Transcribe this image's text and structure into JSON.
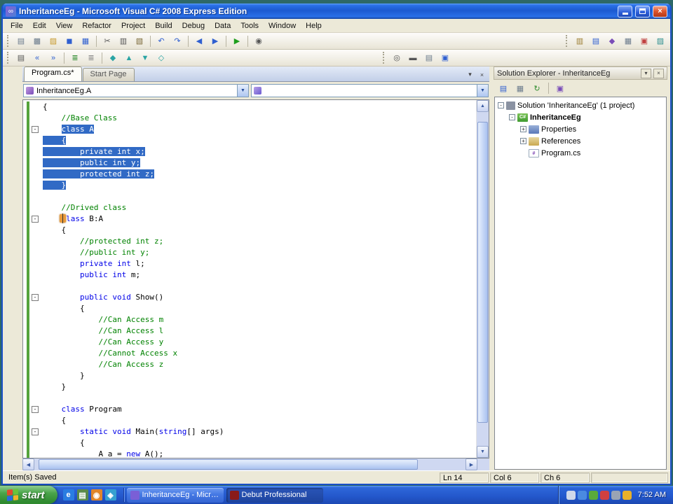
{
  "window": {
    "title": "InheritanceEg - Microsoft Visual C# 2008 Express Edition"
  },
  "colors": {
    "selection": "#316AC5",
    "keyword": "#0000E8",
    "comment": "#008200",
    "titlebar_blue": "#2a70e8",
    "taskbar_blue": "#2458cc",
    "start_green": "#3f9c3f",
    "change_bar_green": "#55a33c",
    "desktop_teal": "#2e6868"
  },
  "menu": {
    "items": [
      "File",
      "Edit",
      "View",
      "Refactor",
      "Project",
      "Build",
      "Debug",
      "Data",
      "Tools",
      "Window",
      "Help"
    ]
  },
  "toolbars": {
    "row1": [
      {
        "name": "new-project-button",
        "glyph": "▤",
        "color": "#6b7b8c"
      },
      {
        "name": "add-new-item-button",
        "glyph": "▩",
        "color": "#6b7b8c"
      },
      {
        "name": "open-file-button",
        "glyph": "▨",
        "color": "#c79a2e"
      },
      {
        "name": "save-button",
        "glyph": "◼",
        "color": "#2f5fd0"
      },
      {
        "name": "save-all-button",
        "glyph": "▦",
        "color": "#2f5fd0"
      },
      {
        "sep": true
      },
      {
        "name": "cut-button",
        "glyph": "✂",
        "color": "#555555"
      },
      {
        "name": "copy-button",
        "glyph": "▥",
        "color": "#555555"
      },
      {
        "name": "paste-button",
        "glyph": "▧",
        "color": "#7c6a3a"
      },
      {
        "sep": true
      },
      {
        "name": "undo-button",
        "glyph": "↶",
        "color": "#2f5fd0"
      },
      {
        "name": "redo-button",
        "glyph": "↷",
        "color": "#2f5fd0"
      },
      {
        "sep": true
      },
      {
        "name": "navigate-backward-button",
        "glyph": "◀",
        "color": "#2f5fd0"
      },
      {
        "name": "navigate-forward-button",
        "glyph": "▶",
        "color": "#2f5fd0"
      },
      {
        "sep": true
      },
      {
        "name": "start-debugging-button",
        "glyph": "▶",
        "color": "#1d9e1d"
      },
      {
        "sep": true
      },
      {
        "name": "find-button",
        "glyph": "◉",
        "color": "#555555"
      }
    ],
    "row1_right": [
      {
        "name": "solution-explorer-button",
        "glyph": "▥",
        "color": "#9a7b2e"
      },
      {
        "name": "properties-window-button",
        "glyph": "▤",
        "color": "#2f5fd0"
      },
      {
        "name": "object-browser-button",
        "glyph": "◆",
        "color": "#7a4db8"
      },
      {
        "name": "toolbox-button",
        "glyph": "▦",
        "color": "#6b7b8c"
      },
      {
        "name": "error-list-button",
        "glyph": "▣",
        "color": "#c04040"
      },
      {
        "name": "start-page-button",
        "glyph": "▨",
        "color": "#2f8f8f"
      }
    ],
    "row2": [
      {
        "name": "display-member-list-button",
        "glyph": "▤",
        "color": "#555555"
      },
      {
        "name": "decrease-indent-button",
        "glyph": "«",
        "color": "#2f5fd0"
      },
      {
        "name": "increase-indent-button",
        "glyph": "»",
        "color": "#2f5fd0"
      },
      {
        "sep": true
      },
      {
        "name": "comment-selection-button",
        "glyph": "≣",
        "color": "#2e8b2e"
      },
      {
        "name": "uncomment-selection-button",
        "glyph": "≣",
        "color": "#888888"
      },
      {
        "sep": true
      },
      {
        "name": "toggle-bookmark-button",
        "glyph": "◆",
        "color": "#2aa4a4"
      },
      {
        "name": "previous-bookmark-button",
        "glyph": "▲",
        "color": "#2aa4a4"
      },
      {
        "name": "next-bookmark-button",
        "glyph": "▼",
        "color": "#2aa4a4"
      },
      {
        "name": "clear-bookmarks-button",
        "glyph": "◇",
        "color": "#2aa4a4"
      }
    ],
    "row2_right": [
      {
        "name": "find-symbol-button",
        "glyph": "◎",
        "color": "#555555"
      },
      {
        "name": "command-window-button",
        "glyph": "▬",
        "color": "#555555"
      },
      {
        "name": "output-window-button",
        "glyph": "▤",
        "color": "#6b7b8c"
      },
      {
        "name": "immediate-window-button",
        "glyph": "▣",
        "color": "#2f5fd0"
      }
    ]
  },
  "tabs": [
    {
      "label": "Program.cs*",
      "active": true
    },
    {
      "label": "Start Page",
      "active": false
    }
  ],
  "navbar": {
    "types_value": "InheritanceEg.A",
    "members_value": ""
  },
  "editor": {
    "lines": [
      {
        "seg": [
          [
            "{",
            "p"
          ]
        ]
      },
      {
        "seg": [
          [
            "    ",
            "p"
          ],
          [
            "//Base Class",
            "c"
          ]
        ]
      },
      {
        "text": "    class A",
        "sel": 4,
        "fold": true
      },
      {
        "text": "    {",
        "sel": 0
      },
      {
        "text": "        private int x;",
        "sel": 0
      },
      {
        "text": "        public int y;",
        "sel": 0
      },
      {
        "text": "        protected int z;",
        "sel": 0
      },
      {
        "text": "    }",
        "sel": 0
      },
      {
        "seg": []
      },
      {
        "seg": [
          [
            "    ",
            "p"
          ],
          [
            "//Drived class",
            "c"
          ]
        ]
      },
      {
        "seg": [
          [
            "    ",
            "p"
          ],
          [
            "class",
            "k"
          ],
          [
            " B:A",
            "p"
          ]
        ],
        "fold": true
      },
      {
        "seg": [
          [
            "    {",
            "p"
          ]
        ]
      },
      {
        "seg": [
          [
            "        ",
            "p"
          ],
          [
            "//protected int z;",
            "c"
          ]
        ]
      },
      {
        "seg": [
          [
            "        ",
            "p"
          ],
          [
            "//public int y;",
            "c"
          ]
        ]
      },
      {
        "seg": [
          [
            "        ",
            "p"
          ],
          [
            "private",
            "k"
          ],
          [
            " ",
            "p"
          ],
          [
            "int",
            "k"
          ],
          [
            " l;",
            "p"
          ]
        ]
      },
      {
        "seg": [
          [
            "        ",
            "p"
          ],
          [
            "public",
            "k"
          ],
          [
            " ",
            "p"
          ],
          [
            "int",
            "k"
          ],
          [
            " m;",
            "p"
          ]
        ]
      },
      {
        "seg": []
      },
      {
        "seg": [
          [
            "        ",
            "p"
          ],
          [
            "public",
            "k"
          ],
          [
            " ",
            "p"
          ],
          [
            "void",
            "k"
          ],
          [
            " Show()",
            "p"
          ]
        ],
        "fold": true
      },
      {
        "seg": [
          [
            "        {",
            "p"
          ]
        ]
      },
      {
        "seg": [
          [
            "            ",
            "p"
          ],
          [
            "//Can Access m",
            "c"
          ]
        ]
      },
      {
        "seg": [
          [
            "            ",
            "p"
          ],
          [
            "//Can Access l",
            "c"
          ]
        ]
      },
      {
        "seg": [
          [
            "            ",
            "p"
          ],
          [
            "//Can Access y",
            "c"
          ]
        ]
      },
      {
        "seg": [
          [
            "            ",
            "p"
          ],
          [
            "//Cannot Access x",
            "c"
          ]
        ]
      },
      {
        "seg": [
          [
            "            ",
            "p"
          ],
          [
            "//Can Access z",
            "c"
          ]
        ]
      },
      {
        "seg": [
          [
            "        }",
            "p"
          ]
        ]
      },
      {
        "seg": [
          [
            "    }",
            "p"
          ]
        ]
      },
      {
        "seg": []
      },
      {
        "seg": [
          [
            "    ",
            "p"
          ],
          [
            "class",
            "k"
          ],
          [
            " Program",
            "p"
          ]
        ],
        "fold": true
      },
      {
        "seg": [
          [
            "    {",
            "p"
          ]
        ]
      },
      {
        "seg": [
          [
            "        ",
            "p"
          ],
          [
            "static",
            "k"
          ],
          [
            " ",
            "p"
          ],
          [
            "void",
            "k"
          ],
          [
            " Main(",
            "p"
          ],
          [
            "string",
            "k"
          ],
          [
            "[] args)",
            "p"
          ]
        ],
        "fold": true
      },
      {
        "seg": [
          [
            "        {",
            "p"
          ]
        ]
      },
      {
        "seg": [
          [
            "            A a = ",
            "p"
          ],
          [
            "new",
            "k"
          ],
          [
            " A();",
            "p"
          ]
        ]
      }
    ]
  },
  "solution_explorer": {
    "title": "Solution Explorer - InheritanceEg",
    "toolbar": [
      {
        "name": "properties-button",
        "glyph": "▤",
        "color": "#2f5fd0"
      },
      {
        "name": "show-all-files-button",
        "glyph": "▦",
        "color": "#6b7b8c"
      },
      {
        "name": "refresh-button",
        "glyph": "↻",
        "color": "#2e8b2e"
      },
      {
        "sep": true
      },
      {
        "name": "view-class-diagram-button",
        "glyph": "▣",
        "color": "#7a4db8"
      }
    ],
    "tree": [
      {
        "label": "Solution 'InheritanceEg' (1 project)",
        "level": 0,
        "exp": "-",
        "icon": "solution"
      },
      {
        "label": "InheritanceEg",
        "level": 1,
        "exp": "-",
        "icon": "csharp-project",
        "bold": true
      },
      {
        "label": "Properties",
        "level": 2,
        "exp": "+",
        "icon": "properties-folder"
      },
      {
        "label": "References",
        "level": 2,
        "exp": "+",
        "icon": "references-folder"
      },
      {
        "label": "Program.cs",
        "level": 2,
        "exp": "",
        "icon": "csharp-file"
      }
    ]
  },
  "statusbar": {
    "message": "Item(s) Saved",
    "ln": "Ln 14",
    "col": "Col 6",
    "ch": "Ch 6"
  },
  "taskbar": {
    "start_label": "start",
    "clock": "7:52 AM",
    "quick_launch": [
      {
        "name": "internet-explorer-icon",
        "glyph": "e",
        "color": "#2a7de1"
      },
      {
        "name": "show-desktop-icon",
        "glyph": "▤",
        "color": "#5a8a4a"
      },
      {
        "name": "media-player-icon",
        "glyph": "◉",
        "color": "#e0862a"
      },
      {
        "name": "messenger-icon",
        "glyph": "◈",
        "color": "#35a0d0"
      }
    ],
    "tasks": [
      {
        "name": "task-button-inheritanceeg",
        "label": "InheritanceEg - Micro...",
        "icon_color": "#7a5fd6",
        "active": false
      },
      {
        "name": "task-button-debut-professional",
        "label": "Debut Professional",
        "icon_color": "#8a1a1a",
        "active": true
      }
    ],
    "tray_icons": [
      {
        "name": "volume-icon",
        "color": "#cfd8ea"
      },
      {
        "name": "network-icon",
        "color": "#4a8ae0"
      },
      {
        "name": "security-shield-icon",
        "color": "#5aaa3a"
      },
      {
        "name": "antivirus-icon",
        "color": "#d04040"
      },
      {
        "name": "usb-device-icon",
        "color": "#9aa4b4"
      },
      {
        "name": "update-icon",
        "color": "#e8b02a"
      }
    ]
  }
}
